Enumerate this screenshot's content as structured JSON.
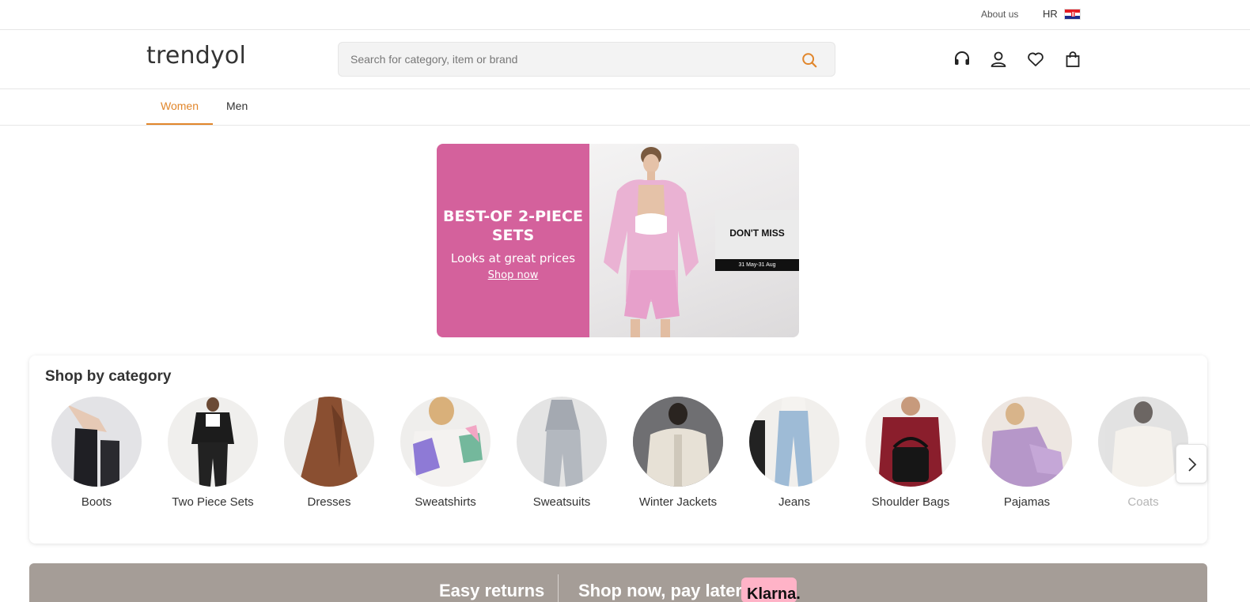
{
  "topbar": {
    "about_label": "About us",
    "language_code": "HR",
    "flag_icon": "croatia-flag-icon"
  },
  "header": {
    "logo_text": "trendyol",
    "search": {
      "placeholder": "Search for category, item or brand",
      "value": "",
      "icon": "search-icon"
    },
    "icons": [
      "headset-icon",
      "user-icon",
      "heart-icon",
      "shopping-bag-icon"
    ]
  },
  "tabs": {
    "items": [
      {
        "label": "Women",
        "active": true
      },
      {
        "label": "Men",
        "active": false
      }
    ]
  },
  "banner": {
    "title": "BEST-OF 2-PIECE SETS",
    "subtitle": "Looks at great prices",
    "link": "Shop now",
    "badge": "DON'T MISS",
    "date": "31 May-31 Aug",
    "accent_color": "#d4619c"
  },
  "categories": {
    "title": "Shop by category",
    "items": [
      {
        "label": "Boots"
      },
      {
        "label": "Two Piece Sets"
      },
      {
        "label": "Dresses"
      },
      {
        "label": "Sweatshirts"
      },
      {
        "label": "Sweatsuits"
      },
      {
        "label": "Winter Jackets"
      },
      {
        "label": "Jeans"
      },
      {
        "label": "Shoulder Bags"
      },
      {
        "label": "Pajamas"
      },
      {
        "label": "Coats"
      }
    ],
    "next_icon": "chevron-right-icon"
  },
  "strip": {
    "left_text": "Easy returns",
    "right_text": "Shop now, pay later",
    "klarna_text": "Klarna."
  },
  "colors": {
    "accent": "#e1862b",
    "strip_bg": "#a59d97",
    "klarna_pink": "#ffb3c7"
  }
}
